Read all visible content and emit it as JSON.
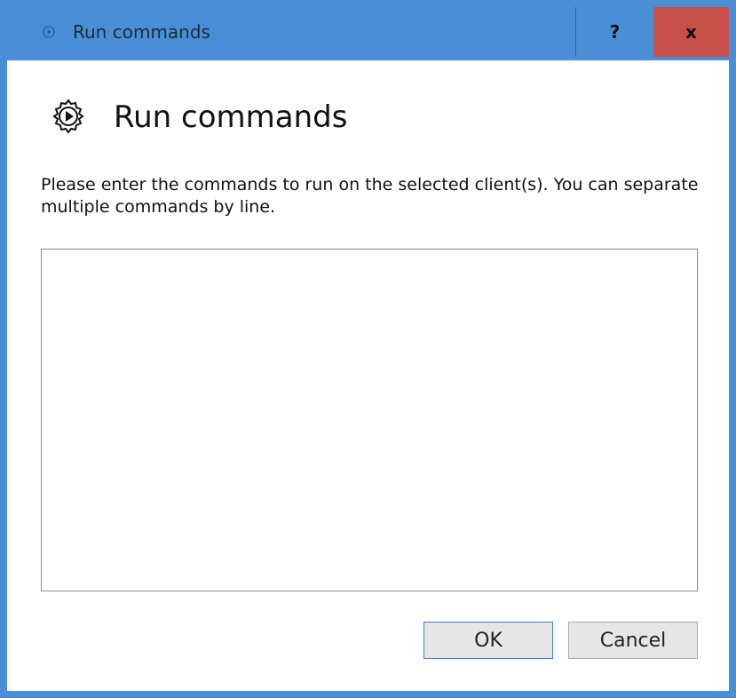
{
  "window": {
    "title": "Run commands",
    "help_label": "?",
    "close_label": "x",
    "accent_color": "#4a8fd6",
    "close_color": "#c7504b"
  },
  "dialog": {
    "heading": "Run commands",
    "description": "Please enter the commands to run on the selected client(s). You can separate multiple commands by line.",
    "commands_value": "",
    "ok_label": "OK",
    "cancel_label": "Cancel",
    "icon": "play-gear-icon"
  }
}
